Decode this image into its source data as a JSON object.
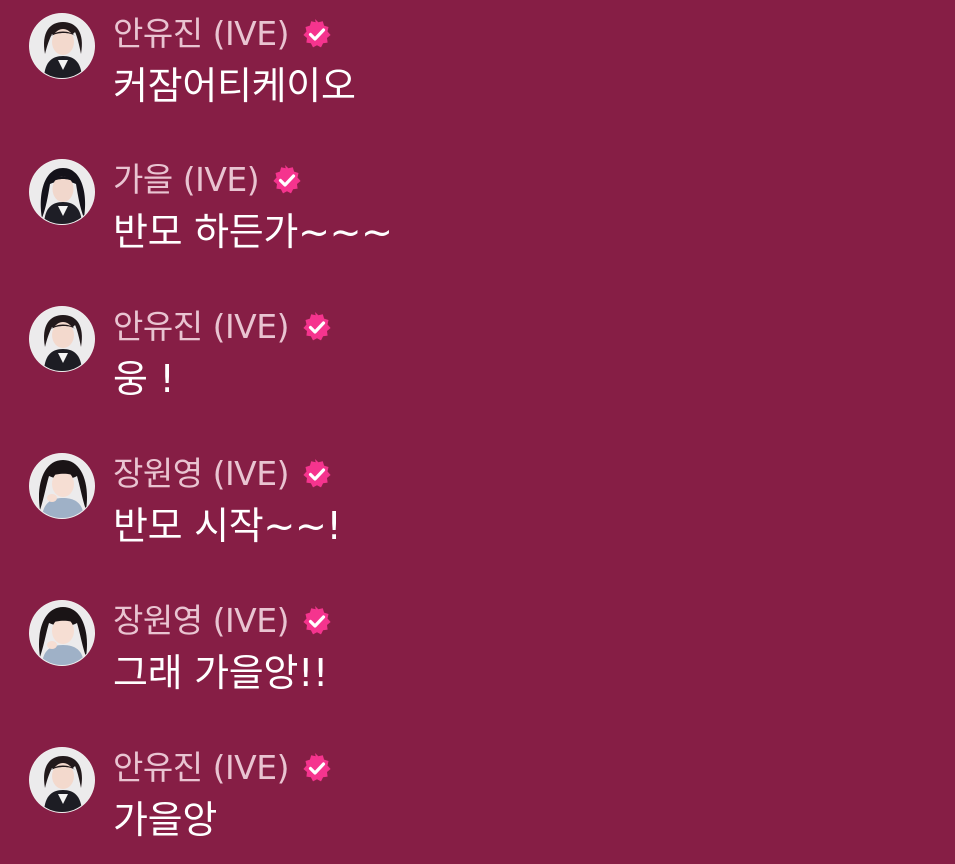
{
  "theme": {
    "background": "#861e45",
    "sender_color": "#e9c4d1",
    "message_color": "#ffffff",
    "verified_badge_color": "#f5348e"
  },
  "messages": [
    {
      "sender": "안유진 (IVE)",
      "text": "커잠어티케이오",
      "avatar_icon": "member-portrait-anyujin",
      "verified": true
    },
    {
      "sender": "가을 (IVE)",
      "text": "반모 하든가~~~",
      "avatar_icon": "member-portrait-gaeul",
      "verified": true
    },
    {
      "sender": "안유진 (IVE)",
      "text": "웅 !",
      "avatar_icon": "member-portrait-anyujin",
      "verified": true
    },
    {
      "sender": "장원영 (IVE)",
      "text": "반모 시작~~!",
      "avatar_icon": "member-portrait-jangwonyoung",
      "verified": true
    },
    {
      "sender": "장원영 (IVE)",
      "text": "그래 가을앙!!",
      "avatar_icon": "member-portrait-jangwonyoung",
      "verified": true
    },
    {
      "sender": "안유진 (IVE)",
      "text": "가을앙",
      "avatar_icon": "member-portrait-anyujin",
      "verified": true
    }
  ]
}
